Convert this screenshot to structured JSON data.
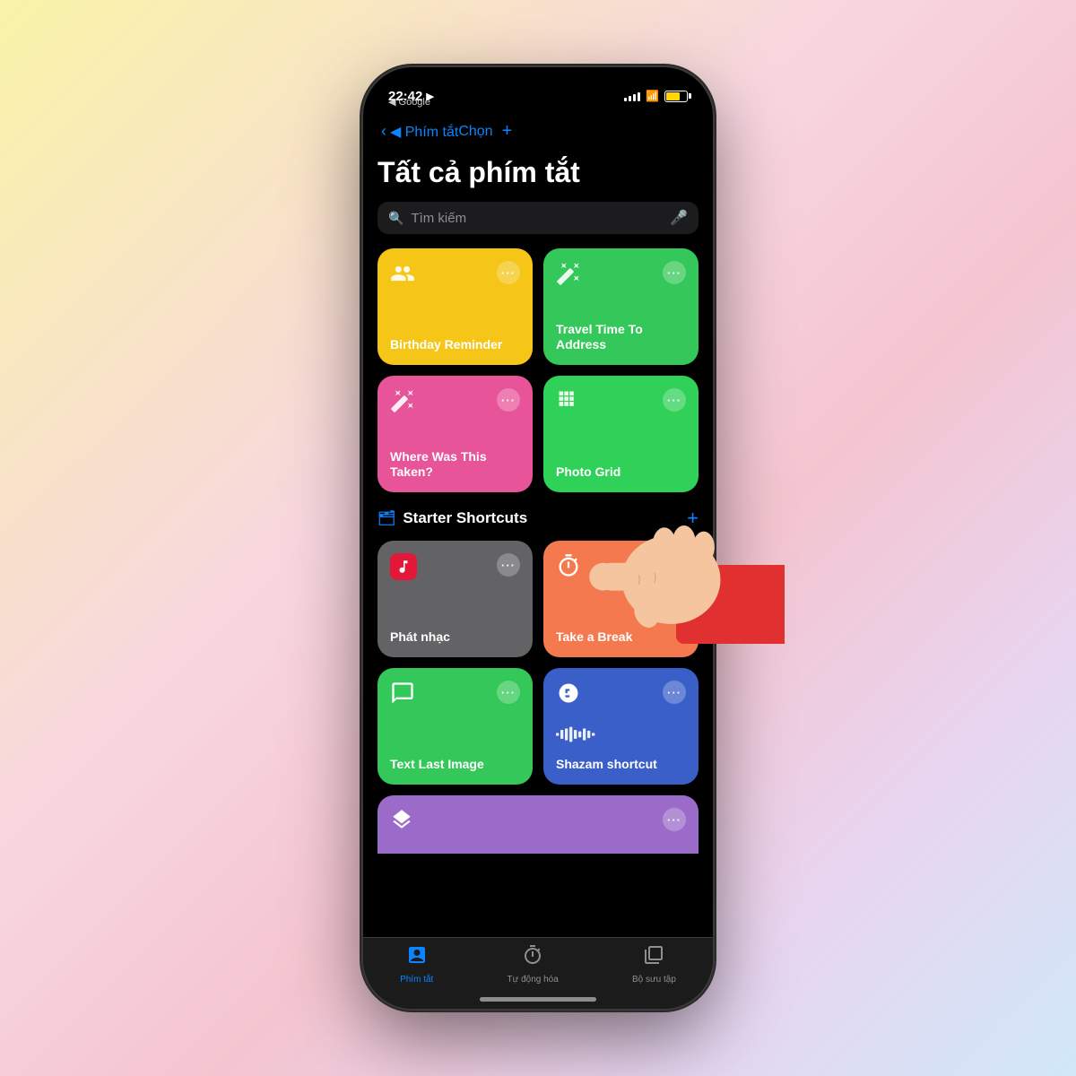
{
  "background": {
    "gradient": "linear-gradient(135deg, #f9f4a8 0%, #f8d6e0 40%, #f4c5d0 60%, #e8d5f0 80%, #d0e8f8 100%)"
  },
  "statusBar": {
    "time": "22:42",
    "arrow": "▶",
    "backLabel": "◀ Google",
    "signal": [
      3,
      5,
      7,
      9,
      11
    ],
    "battery": "70"
  },
  "navBar": {
    "backLabel": "◀ Phím tắt",
    "chooseLabel": "Chọn",
    "plusLabel": "+"
  },
  "pageTitle": "Tất cả phím tắt",
  "search": {
    "placeholder": "Tìm kiếm"
  },
  "shortcuts": [
    {
      "id": "birthday-reminder",
      "label": "Birthday Reminder",
      "color": "card-yellow",
      "icon": "people"
    },
    {
      "id": "travel-time",
      "label": "Travel Time To Address",
      "color": "card-green",
      "icon": "wand"
    },
    {
      "id": "where-was-taken",
      "label": "Where Was This Taken?",
      "color": "card-pink",
      "icon": "wand"
    },
    {
      "id": "photo-grid",
      "label": "Photo Grid",
      "color": "card-green-dark",
      "icon": "grid"
    }
  ],
  "starterSection": {
    "title": "Starter Shortcuts",
    "folderIcon": "📁"
  },
  "starterShortcuts": [
    {
      "id": "phat-nhac",
      "label": "Phát nhạc",
      "color": "card-gray",
      "icon": "music"
    },
    {
      "id": "take-a-break",
      "label": "Take a Break",
      "color": "card-orange",
      "icon": "timer"
    },
    {
      "id": "text-last-image",
      "label": "Text Last Image",
      "color": "card-green-msg",
      "icon": "message"
    },
    {
      "id": "shazam-shortcut",
      "label": "Shazam shortcut",
      "color": "card-blue",
      "icon": "shazam"
    }
  ],
  "partialCard": {
    "color": "card-purple",
    "icon": "stack"
  },
  "tabBar": {
    "tabs": [
      {
        "id": "shortcuts",
        "label": "Phím tắt",
        "icon": "⊞",
        "active": true
      },
      {
        "id": "automation",
        "label": "Tự động hóa",
        "icon": "⏱",
        "active": false
      },
      {
        "id": "collection",
        "label": "Bộ sưu tập",
        "icon": "⊡",
        "active": false
      }
    ]
  }
}
